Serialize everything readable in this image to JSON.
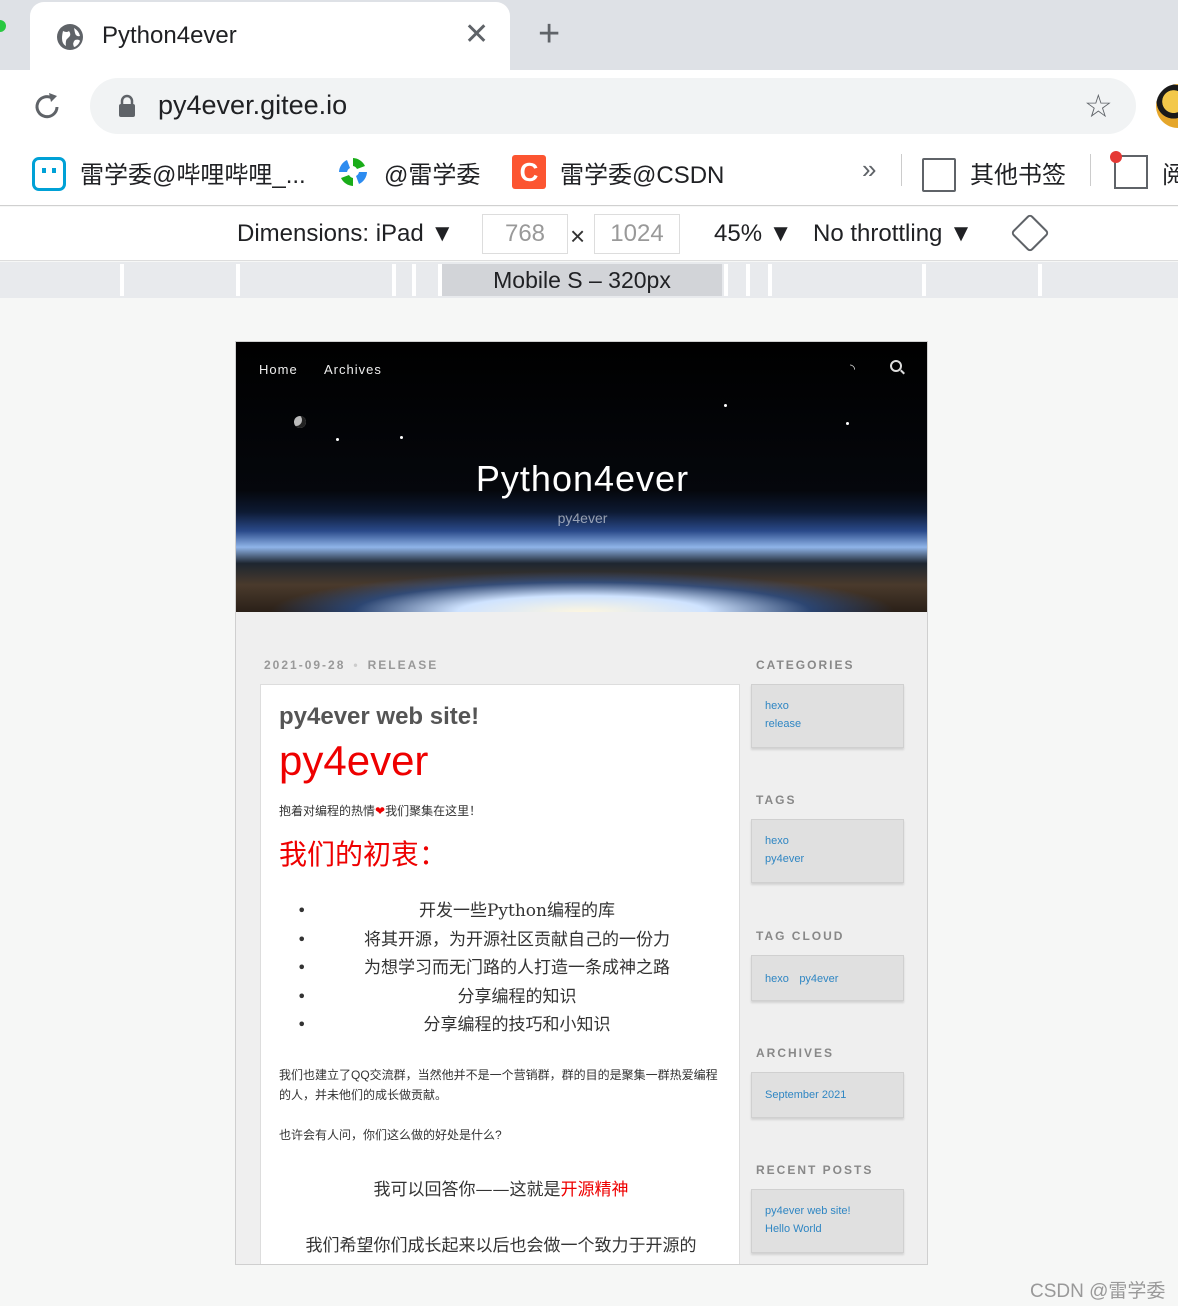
{
  "browser": {
    "tab": {
      "title": "Python4ever"
    },
    "address": {
      "url": "py4ever.gitee.io"
    },
    "bookmarks": [
      {
        "label": "雷学委@哔哩哔哩_..."
      },
      {
        "label": "@雷学委"
      },
      {
        "label": "雷学委@CSDN"
      }
    ],
    "bookmarks_more": "»",
    "other_bookmarks": "其他书签",
    "reading_list": "阅"
  },
  "device_toolbar": {
    "dimensions_label": "Dimensions: iPad ▼",
    "width": "768",
    "height": "1024",
    "times": "×",
    "zoom": "45% ▼",
    "throttling": "No throttling ▼",
    "media_query": "Mobile S – 320px"
  },
  "site": {
    "nav": {
      "home": "Home",
      "archives": "Archives"
    },
    "title": "Python4ever",
    "subtitle": "py4ever"
  },
  "post": {
    "date": "2021-09-28",
    "category": "RELEASE",
    "title": "py4ever web site!",
    "h1": "py4ever",
    "intro_before": "抱着对编程的热情",
    "intro_heart": "❤",
    "intro_after": "我们聚集在这里！",
    "h2": "我们的初衷：",
    "goals": [
      "开发一些Python编程的库",
      "将其开源，为开源社区贡献自己的一份力",
      "为想学习而无门路的人打造一条成神之路",
      "分享编程的知识",
      "分享编程的技巧和小知识"
    ],
    "para1": "我们也建立了QQ交流群，当然他并不是一个营销群，群的目的是聚集一群热爱编程的人，并未他们的成长做贡献。",
    "para2": "也许会有人问，你们这么做的好处是什么?",
    "answer_before": "我可以回答你——这就是",
    "answer_red": "开源精神",
    "hope": "我们希望你们成长起来以后也会做一个致力于开源的"
  },
  "sidebar": {
    "categories": {
      "title": "CATEGORIES",
      "items": [
        "hexo",
        "release"
      ]
    },
    "tags": {
      "title": "TAGS",
      "items": [
        "hexo",
        "py4ever"
      ]
    },
    "tag_cloud": {
      "title": "TAG CLOUD",
      "items": [
        "hexo",
        "py4ever"
      ]
    },
    "archives": {
      "title": "ARCHIVES",
      "items": [
        "September 2021"
      ]
    },
    "recent_posts": {
      "title": "RECENT POSTS",
      "items": [
        "py4ever web site!",
        "Hello World"
      ]
    }
  },
  "watermark": "CSDN @雷学委",
  "colors": {
    "accent_red": "#ee0000",
    "link_blue": "#2f86c3",
    "csdn_orange": "#fc5531",
    "bilibili_blue": "#00a1d6"
  }
}
